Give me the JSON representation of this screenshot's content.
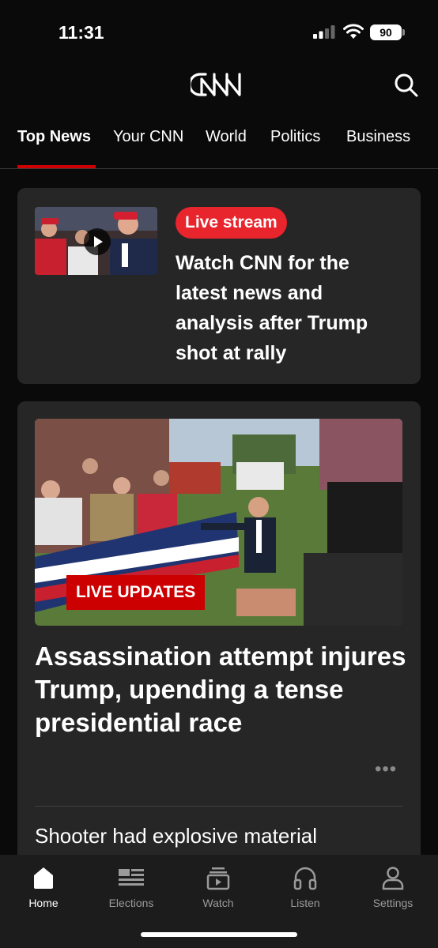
{
  "status_bar": {
    "time": "11:31",
    "battery": "90"
  },
  "header": {
    "logo_icon": "cnn-logo",
    "search_icon": "search-icon"
  },
  "tabs": [
    {
      "label": "Top News",
      "active": true
    },
    {
      "label": "Your CNN"
    },
    {
      "label": "World"
    },
    {
      "label": "Politics"
    },
    {
      "label": "Business"
    }
  ],
  "live_card": {
    "badge": "Live stream",
    "title": "Watch CNN for the latest news and analysis after Trump shot at rally"
  },
  "main_story": {
    "badge": "LIVE UPDATES",
    "headline": "Assassination attempt injures Trump, upending a tense presidential race",
    "more": "•••",
    "next_headline": "Shooter had explosive material"
  },
  "bottom_nav": [
    {
      "label": "Home",
      "icon": "home-icon",
      "active": true
    },
    {
      "label": "Elections",
      "icon": "elections-icon"
    },
    {
      "label": "Watch",
      "icon": "watch-icon"
    },
    {
      "label": "Listen",
      "icon": "headphones-icon"
    },
    {
      "label": "Settings",
      "icon": "person-icon"
    }
  ],
  "colors": {
    "accent": "#cc0000",
    "live_pill": "#e8242d",
    "card": "#262626",
    "background": "#0a0a0a"
  }
}
